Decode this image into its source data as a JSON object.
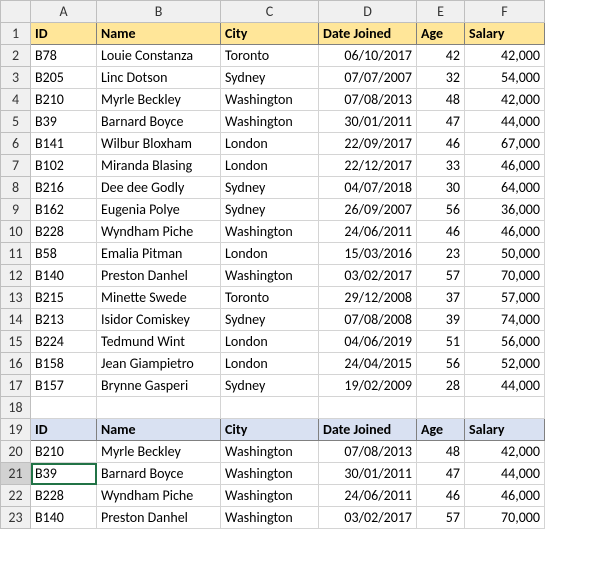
{
  "columns": [
    "A",
    "B",
    "C",
    "D",
    "E",
    "F"
  ],
  "row_count": 23,
  "active_cell": {
    "row": 21,
    "col": "A"
  },
  "headers_top": {
    "A": "ID",
    "B": "Name",
    "C": "City",
    "D": "Date Joined",
    "E": "Age",
    "F": "Salary"
  },
  "rows_top": [
    {
      "A": "B78",
      "B": "Louie Constanza",
      "C": "Toronto",
      "D": "06/10/2017",
      "E": "42",
      "F": "42,000"
    },
    {
      "A": "B205",
      "B": "Linc Dotson",
      "C": "Sydney",
      "D": "07/07/2007",
      "E": "32",
      "F": "54,000"
    },
    {
      "A": "B210",
      "B": "Myrle Beckley",
      "C": "Washington",
      "D": "07/08/2013",
      "E": "48",
      "F": "42,000"
    },
    {
      "A": "B39",
      "B": "Barnard Boyce",
      "C": "Washington",
      "D": "30/01/2011",
      "E": "47",
      "F": "44,000"
    },
    {
      "A": "B141",
      "B": "Wilbur Bloxham",
      "C": "London",
      "D": "22/09/2017",
      "E": "46",
      "F": "67,000"
    },
    {
      "A": "B102",
      "B": "Miranda Blasing",
      "C": "London",
      "D": "22/12/2017",
      "E": "33",
      "F": "46,000"
    },
    {
      "A": "B216",
      "B": "Dee dee Godly",
      "C": "Sydney",
      "D": "04/07/2018",
      "E": "30",
      "F": "64,000"
    },
    {
      "A": "B162",
      "B": "Eugenia Polye",
      "C": "Sydney",
      "D": "26/09/2007",
      "E": "56",
      "F": "36,000"
    },
    {
      "A": "B228",
      "B": "Wyndham Piche",
      "C": "Washington",
      "D": "24/06/2011",
      "E": "46",
      "F": "46,000"
    },
    {
      "A": "B58",
      "B": "Emalia Pitman",
      "C": "London",
      "D": "15/03/2016",
      "E": "23",
      "F": "50,000"
    },
    {
      "A": "B140",
      "B": "Preston Danhel",
      "C": "Washington",
      "D": "03/02/2017",
      "E": "57",
      "F": "70,000"
    },
    {
      "A": "B215",
      "B": "Minette Swede",
      "C": "Toronto",
      "D": "29/12/2008",
      "E": "37",
      "F": "57,000"
    },
    {
      "A": "B213",
      "B": "Isidor Comiskey",
      "C": "Sydney",
      "D": "07/08/2008",
      "E": "39",
      "F": "74,000"
    },
    {
      "A": "B224",
      "B": "Tedmund Wint",
      "C": "London",
      "D": "04/06/2019",
      "E": "51",
      "F": "56,000"
    },
    {
      "A": "B158",
      "B": "Jean Giampietro",
      "C": "London",
      "D": "24/04/2015",
      "E": "56",
      "F": "52,000"
    },
    {
      "A": "B157",
      "B": "Brynne Gasperi",
      "C": "Sydney",
      "D": "19/02/2009",
      "E": "28",
      "F": "44,000"
    }
  ],
  "headers_bottom": {
    "A": "ID",
    "B": "Name",
    "C": "City",
    "D": "Date Joined",
    "E": "Age",
    "F": "Salary"
  },
  "rows_bottom": [
    {
      "A": "B210",
      "B": "Myrle Beckley",
      "C": "Washington",
      "D": "07/08/2013",
      "E": "48",
      "F": "42,000"
    },
    {
      "A": "B39",
      "B": "Barnard Boyce",
      "C": "Washington",
      "D": "30/01/2011",
      "E": "47",
      "F": "44,000"
    },
    {
      "A": "B228",
      "B": "Wyndham Piche",
      "C": "Washington",
      "D": "24/06/2011",
      "E": "46",
      "F": "46,000"
    },
    {
      "A": "B140",
      "B": "Preston Danhel",
      "C": "Washington",
      "D": "03/02/2017",
      "E": "57",
      "F": "70,000"
    }
  ]
}
